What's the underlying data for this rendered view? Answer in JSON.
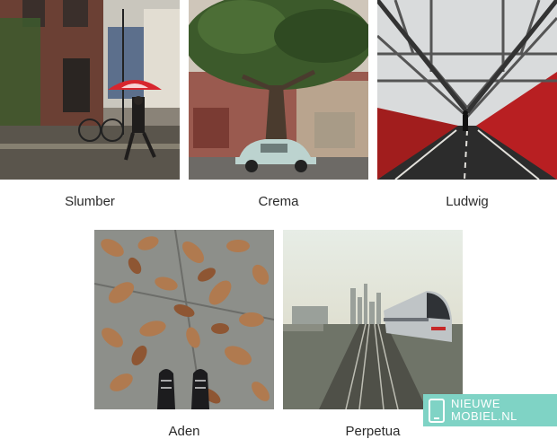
{
  "filters": [
    {
      "id": "slumber",
      "label": "Slumber"
    },
    {
      "id": "crema",
      "label": "Crema"
    },
    {
      "id": "ludwig",
      "label": "Ludwig"
    },
    {
      "id": "aden",
      "label": "Aden"
    },
    {
      "id": "perpetua",
      "label": "Perpetua"
    }
  ],
  "watermark": {
    "line1": "NIEUWE",
    "line2": "MOBIEL.NL"
  }
}
